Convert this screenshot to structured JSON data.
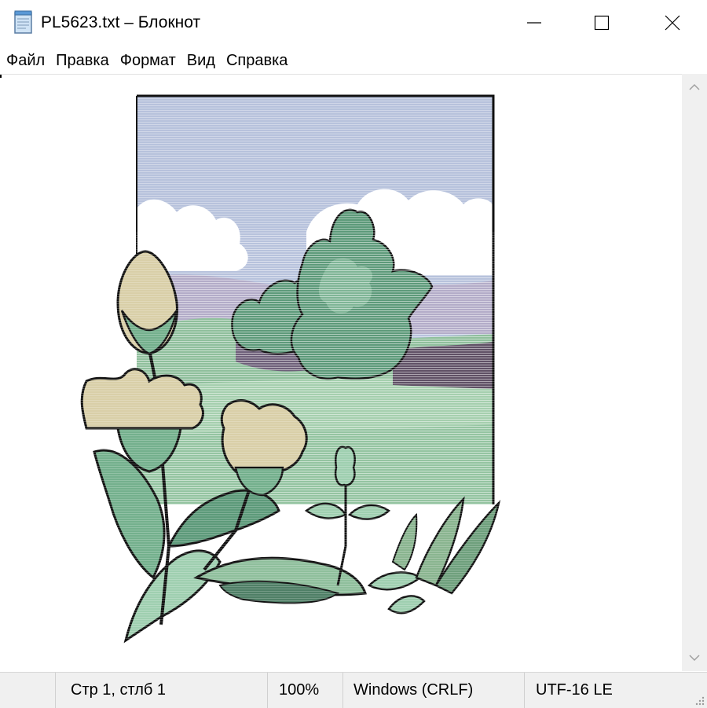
{
  "window": {
    "title": "PL5623.txt – Блокнот",
    "icon": "notepad-icon",
    "controls": {
      "minimize": "minimize-icon",
      "maximize": "maximize-icon",
      "close": "close-icon"
    }
  },
  "menu": {
    "items": [
      {
        "label": "Файл"
      },
      {
        "label": "Правка"
      },
      {
        "label": "Формат"
      },
      {
        "label": "Вид"
      },
      {
        "label": "Справка"
      }
    ]
  },
  "status": {
    "position": "Стр 1, стлб 1",
    "zoom": "100%",
    "line_ending": "Windows (CRLF)",
    "encoding": "UTF-16 LE"
  },
  "colors": {
    "sky": "#b7c2dc",
    "cloud": "#ffffff",
    "hill_lilac": "#b3acc8",
    "field_green": "#8fbf9c",
    "tree_green": "#5d9a7a",
    "leaf_light": "#9fcfb0",
    "flower_beige": "#d9cfa8",
    "outline": "#101010",
    "chrome_bg": "#f0f0f0"
  }
}
